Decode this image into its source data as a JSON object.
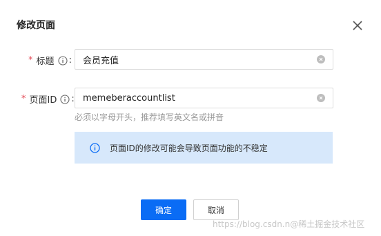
{
  "dialog": {
    "title": "修改页面",
    "close_icon": "close-icon"
  },
  "form": {
    "title_field": {
      "required_mark": "*",
      "label": "标题",
      "colon": ":",
      "value": "会员充值",
      "info_icon": "info-circle-icon",
      "clear_icon": "clear-circle-icon"
    },
    "page_id_field": {
      "required_mark": "*",
      "label": "页面ID",
      "colon": ":",
      "value": "memeberaccountlist",
      "info_icon": "info-circle-icon",
      "clear_icon": "clear-circle-icon",
      "hint": "必须以字母开头，推荐填写英文名或拼音"
    }
  },
  "notice": {
    "icon": "info-circle-icon",
    "text": "页面ID的修改可能会导致页面功能的不稳定"
  },
  "buttons": {
    "confirm_label": "确定",
    "cancel_label": "取消"
  },
  "watermark": {
    "text": "https://blog.csdn.n@稀土掘金技术社区"
  },
  "colors": {
    "primary": "#0a6cf5",
    "required": "#e34d59",
    "notice_bg": "#d7e8fb"
  }
}
